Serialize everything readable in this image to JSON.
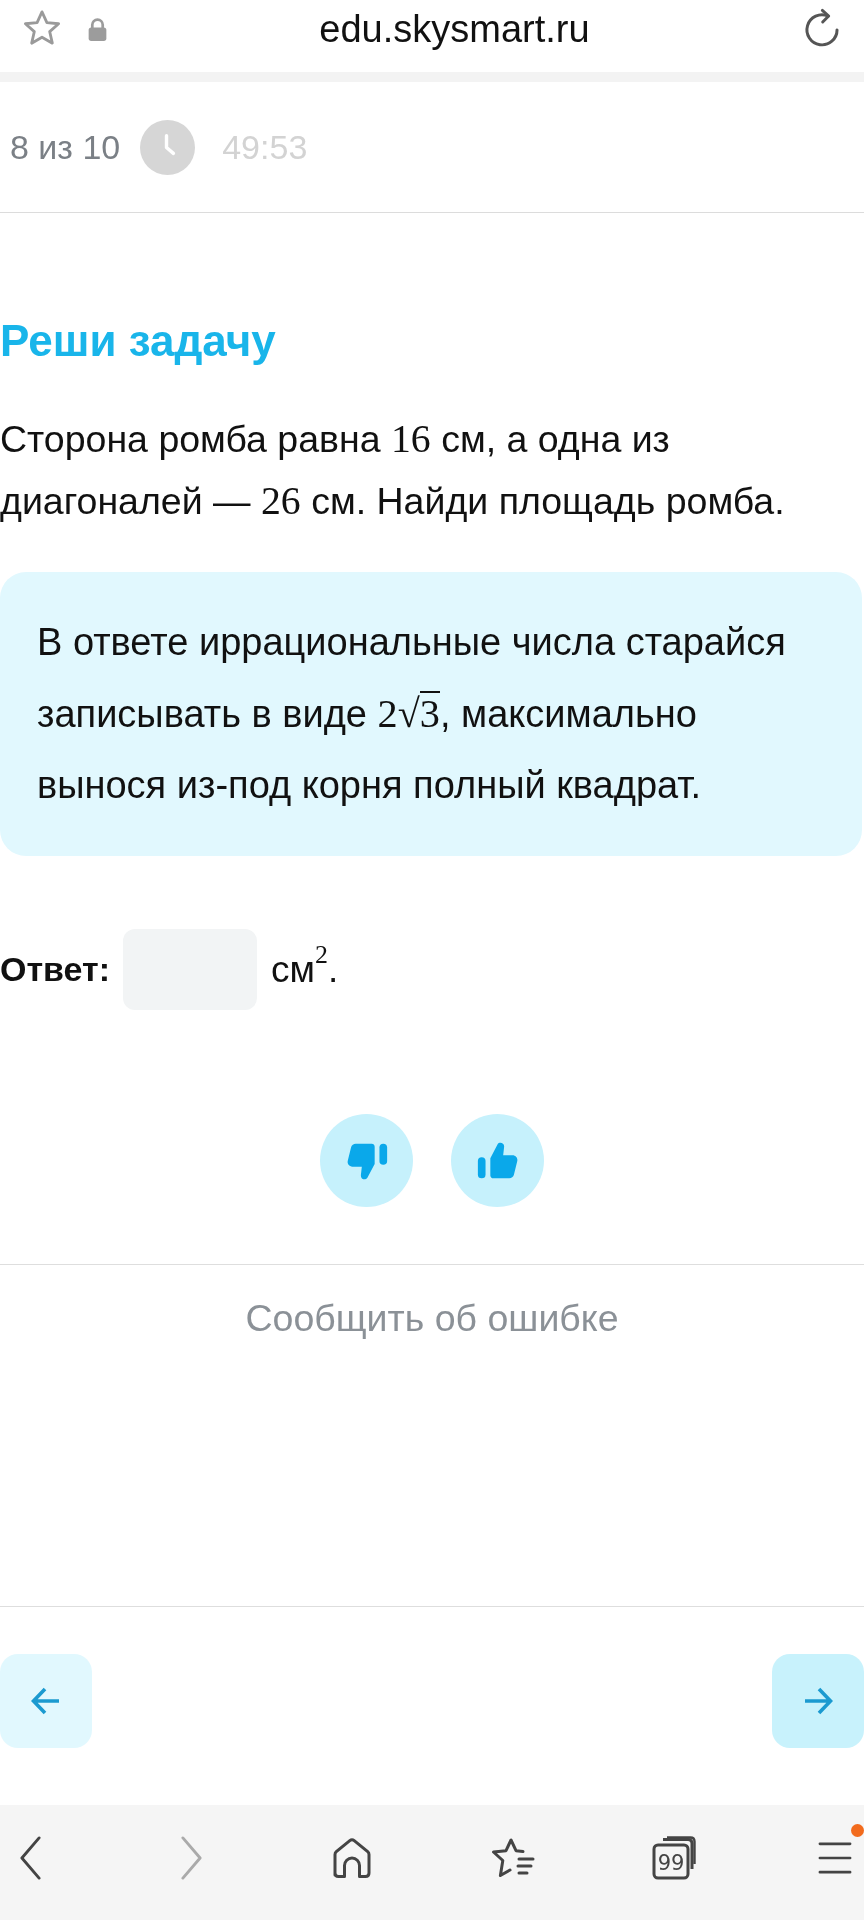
{
  "browser_bar": {
    "url": "edu.skysmart.ru"
  },
  "progress": {
    "counter": "8 из 10",
    "timer": "49:53"
  },
  "task": {
    "heading": "Реши задачу",
    "statement": [
      {
        "kind": "text",
        "text": "Сторона ромба равна "
      },
      {
        "kind": "math",
        "text": "16"
      },
      {
        "kind": "text",
        "text": " см, а одна из диагоналей — "
      },
      {
        "kind": "math",
        "text": "26"
      },
      {
        "kind": "text",
        "text": " см. Найди площадь ромба."
      }
    ]
  },
  "hint": {
    "segments": [
      {
        "kind": "text",
        "text": "В ответе иррациональные числа старайся записывать в виде "
      },
      {
        "kind": "math",
        "text": "2√"
      },
      {
        "kind": "radicand",
        "text": "3"
      },
      {
        "kind": "text",
        "text": ", максимально вынося из-под корня полный квадрат."
      }
    ]
  },
  "answer": {
    "label": "Ответ:",
    "unit": "см$^{2}$."
  },
  "report_link": "Сообщить об ошибке",
  "browser_nav": {
    "back": {
      "disabled": false
    },
    "forward": {
      "disabled": true
    },
    "tab_count": "99",
    "menu": {
      "notification": true
    }
  }
}
